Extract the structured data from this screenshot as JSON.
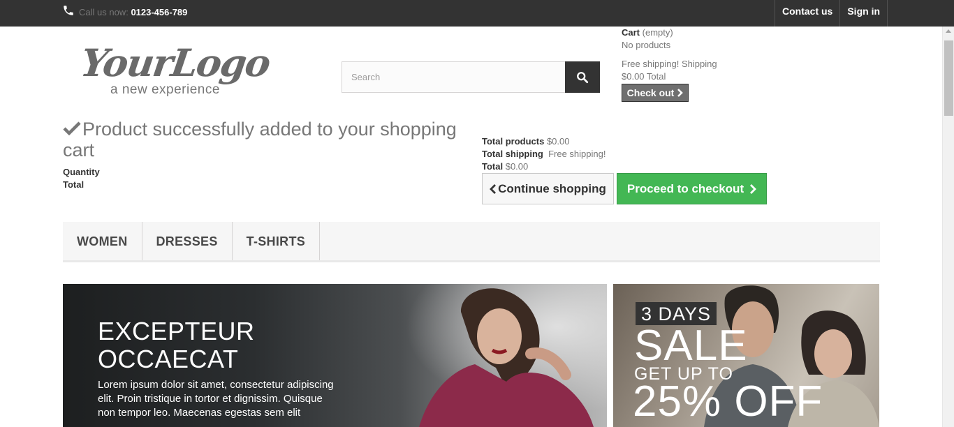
{
  "topbar": {
    "call_label": "Call us now:",
    "phone": "0123-456-789",
    "nav": [
      {
        "label": "Contact us"
      },
      {
        "label": "Sign in"
      }
    ]
  },
  "logo": {
    "main": "YourLogo",
    "tagline": "a new experience"
  },
  "search": {
    "placeholder": "Search"
  },
  "cart": {
    "title": "Cart",
    "status": "(empty)",
    "no_products": "No products",
    "shipping_line": "Free shipping! Shipping",
    "total_line": "$0.00 Total",
    "checkout_label": "Check out"
  },
  "layer_cart": {
    "success_message": "Product successfully added to your shopping cart",
    "quantity_label": "Quantity",
    "total_label": "Total",
    "totals": {
      "products_label": "Total products",
      "products_value": "$0.00",
      "shipping_label": "Total shipping",
      "shipping_value": "Free shipping!",
      "total_label": "Total",
      "total_value": "$0.00"
    },
    "continue_label": "Continue shopping",
    "proceed_label": "Proceed to checkout"
  },
  "menu": {
    "items": [
      {
        "label": "WOMEN"
      },
      {
        "label": "DRESSES"
      },
      {
        "label": "T-SHIRTS"
      }
    ]
  },
  "banner_left": {
    "title_line1": "EXCEPTEUR",
    "title_line2": "OCCAECAT",
    "text": "Lorem ipsum dolor sit amet, consectetur adipiscing elit. Proin tristique in tortor et dignissim. Quisque non tempor leo. Maecenas egestas sem elit"
  },
  "banner_right": {
    "days": "3 DAYS",
    "sale": "SALE",
    "get_up_to": "GET UP TO",
    "off": "25% OFF"
  },
  "colors": {
    "topbar": "#333333",
    "proceed": "#43b754",
    "checkout_mini": "#6f6f6f"
  }
}
